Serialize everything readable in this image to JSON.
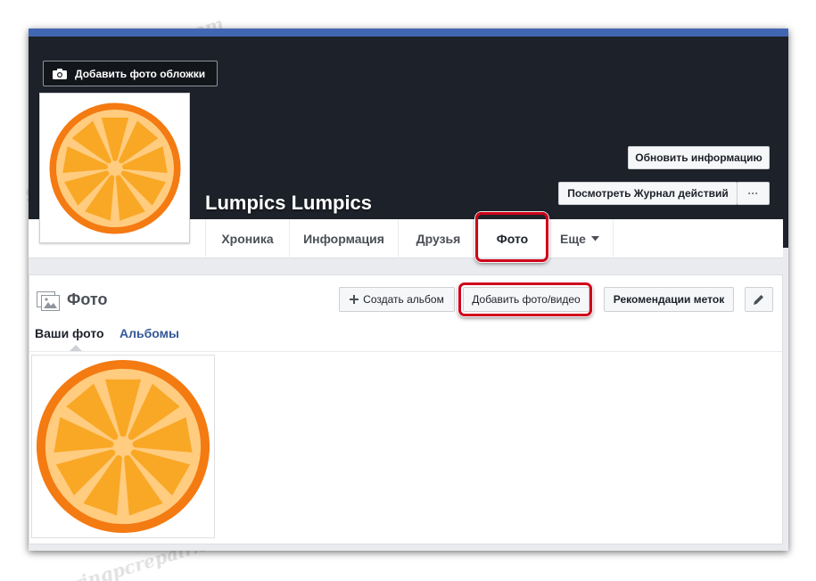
{
  "cover": {
    "add_cover_label": "Добавить фото обложки",
    "profile_name": "Lumpics Lumpics",
    "update_info_label": "Обновить информацию",
    "activity_log_label": "Посмотреть Журнал действий",
    "more_label": "···"
  },
  "nav": {
    "items": [
      {
        "label": "Хроника"
      },
      {
        "label": "Информация"
      },
      {
        "label": "Друзья"
      },
      {
        "label": "Фото"
      },
      {
        "label": "Еще"
      }
    ]
  },
  "photos": {
    "title": "Фото",
    "create_album_label": "Создать альбом",
    "add_photo_video_label": "Добавить фото/видео",
    "tag_suggestions_label": "Рекомендации меток",
    "tabs": [
      {
        "label": "Ваши фото"
      },
      {
        "label": "Альбомы"
      }
    ]
  },
  "watermark": {
    "text": "Soringpcrepair.com"
  },
  "colors": {
    "facebook_blue": "#4267b2",
    "cover_bg": "#1d2129",
    "highlight_red": "#d0021b",
    "orange_rind": "#f47a12",
    "orange_pulp": "#ffcc80",
    "orange_segment": "#f9a825"
  }
}
